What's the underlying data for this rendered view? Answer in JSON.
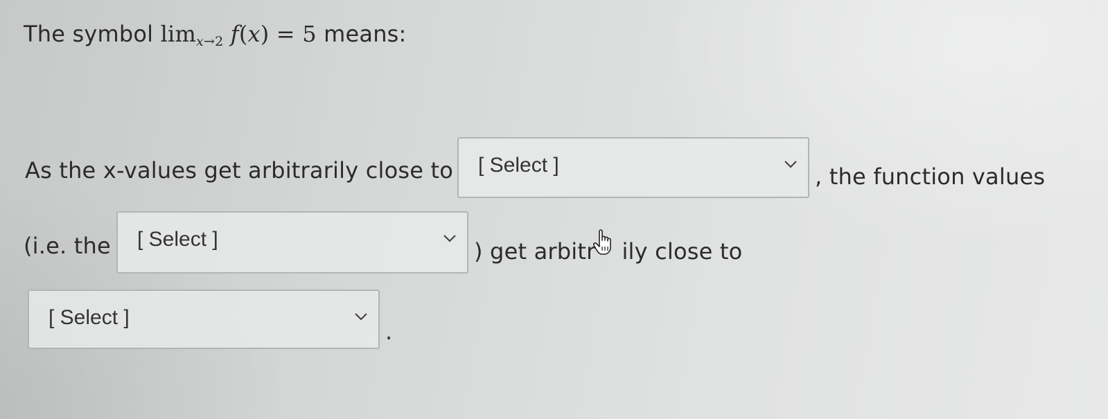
{
  "question": {
    "prefix": "The symbol ",
    "math": {
      "lim": "lim",
      "sub_var": "x",
      "sub_arrow": "→",
      "sub_num": "2",
      "func": "f",
      "open": "(",
      "arg": "x",
      "close": ")",
      "equals": " = 5"
    },
    "suffix": " means:"
  },
  "sentence": {
    "part1": "As the x-values get arbitrarily close to",
    "part2": ", the function values",
    "part3": "(i.e. the",
    "part4_a": ") get arbitr",
    "part4_b": "ily close to",
    "part5": "."
  },
  "selects": {
    "select1": {
      "value": "[ Select ]"
    },
    "select2": {
      "value": "[ Select ]"
    },
    "select3": {
      "value": "[ Select ]"
    }
  },
  "icons": {
    "chevron": "chevron-down-icon",
    "cursor": "hand-pointer-cursor"
  }
}
